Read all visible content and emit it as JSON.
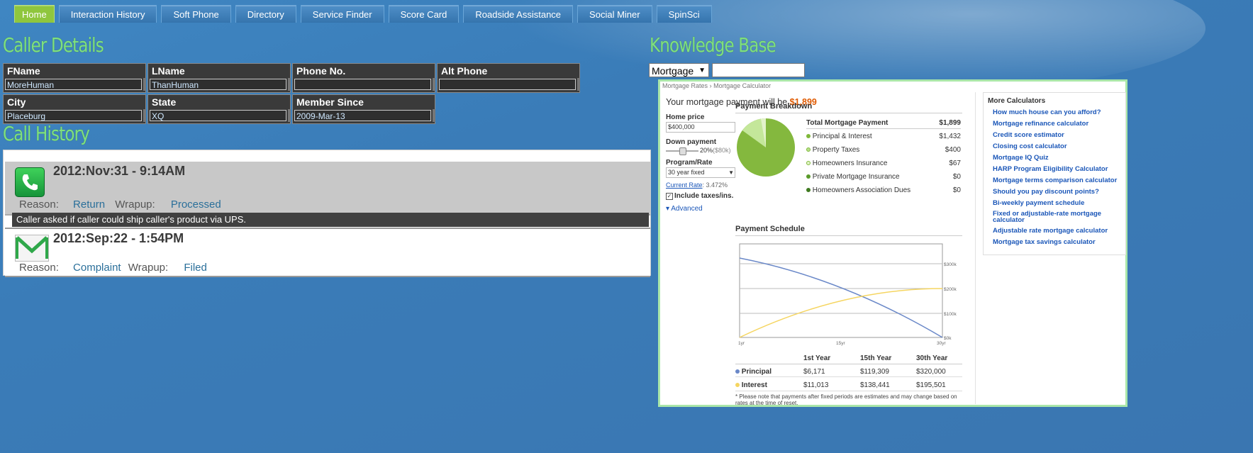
{
  "nav": {
    "tabs": [
      "Home",
      "Interaction History",
      "Soft Phone",
      "Directory",
      "Service Finder",
      "Score Card",
      "Roadside Assistance",
      "Social Miner",
      "SpinSci"
    ],
    "active": "Home"
  },
  "caller_details": {
    "title": "Caller Details",
    "fields": [
      {
        "label": "FName",
        "value": "MoreHuman"
      },
      {
        "label": "LName",
        "value": "ThanHuman"
      },
      {
        "label": "Phone No.",
        "value": ""
      },
      {
        "label": "Alt Phone",
        "value": ""
      },
      {
        "label": "City",
        "value": "Placeburg"
      },
      {
        "label": "State",
        "value": "XQ"
      },
      {
        "label": "Member Since",
        "value": "2009-Mar-13"
      }
    ]
  },
  "call_history": {
    "title": "Call History",
    "items": [
      {
        "date": "2012:Nov:31 - 9:14AM",
        "reason_label": "Reason:",
        "reason": "Return",
        "wrapup_label": "Wrapup:",
        "wrapup": "Processed",
        "note": "Caller asked if caller could ship caller's product via UPS.",
        "icon": "phone-icon"
      },
      {
        "date": "2012:Sep:22 - 1:54PM",
        "reason_label": "Reason:",
        "reason": "Complaint",
        "wrapup_label": "Wrapup:",
        "wrapup": "Filed",
        "icon": "mail-icon"
      }
    ]
  },
  "knowledge_base": {
    "title": "Knowledge Base",
    "select_value": "Mortgage",
    "search_value": "",
    "calculator": {
      "breadcrumb": [
        "Mortgage Rates",
        "›",
        "Mortgage Calculator"
      ],
      "headline_prefix": "Your mortgage payment will be ",
      "headline_value": "$1,899",
      "home_price_label": "Home price",
      "home_price": "$400,000",
      "down_payment_label": "Down payment",
      "down_payment_pct": "20%",
      "down_payment_amt": "($80k)",
      "program_label": "Program/Rate",
      "program_value": "30 year fixed",
      "current_rate_label": "Current Rate",
      "current_rate_value": ": 3.472%",
      "include_taxes": "Include taxes/ins.",
      "advanced": "Advanced",
      "breakdown_title": "Payment Breakdown",
      "breakdown_total_label": "Total Mortgage Payment",
      "breakdown_total": "$1,899",
      "breakdown": [
        {
          "label": "Principal & Interest",
          "value": "$1,432",
          "color": "#7fb83a"
        },
        {
          "label": "Property Taxes",
          "value": "$400",
          "color": "#b7e08a"
        },
        {
          "label": "Homeowners Insurance",
          "value": "$67",
          "color": "#e0f2c4"
        },
        {
          "label": "Private Mortgage Insurance",
          "value": "$0",
          "color": "#5a9a2a"
        },
        {
          "label": "Homeowners Association Dues",
          "value": "$0",
          "color": "#3f7a20"
        }
      ],
      "schedule_title": "Payment Schedule",
      "chart_ticks_y": [
        "$300k",
        "$200k",
        "$100k",
        "$0k"
      ],
      "chart_ticks_x": [
        "1yr",
        "15yr",
        "30yr"
      ],
      "table_headers": [
        "1st Year",
        "15th Year",
        "30th Year"
      ],
      "table_rows": [
        {
          "label": "Principal",
          "values": [
            "$6,171",
            "$119,309",
            "$320,000"
          ],
          "color": "#6a88c8"
        },
        {
          "label": "Interest",
          "values": [
            "$11,013",
            "$138,441",
            "$195,501"
          ],
          "color": "#f5d560"
        }
      ],
      "footnote": "* Please note that payments after fixed periods are estimates and may change based on rates at the time of reset.",
      "more_title": "More Calculators",
      "more": [
        "How much house can you afford?",
        "Mortgage refinance calculator",
        "Credit score estimator",
        "Closing cost calculator",
        "Mortgage IQ Quiz",
        "HARP Program Eligibility Calculator",
        "Mortgage terms comparison calculator",
        "Should you pay discount points?",
        "Bi-weekly payment schedule",
        "Fixed or adjustable-rate mortgage calculator",
        "Adjustable rate mortgage calculator",
        "Mortgage tax savings calculator"
      ]
    }
  }
}
